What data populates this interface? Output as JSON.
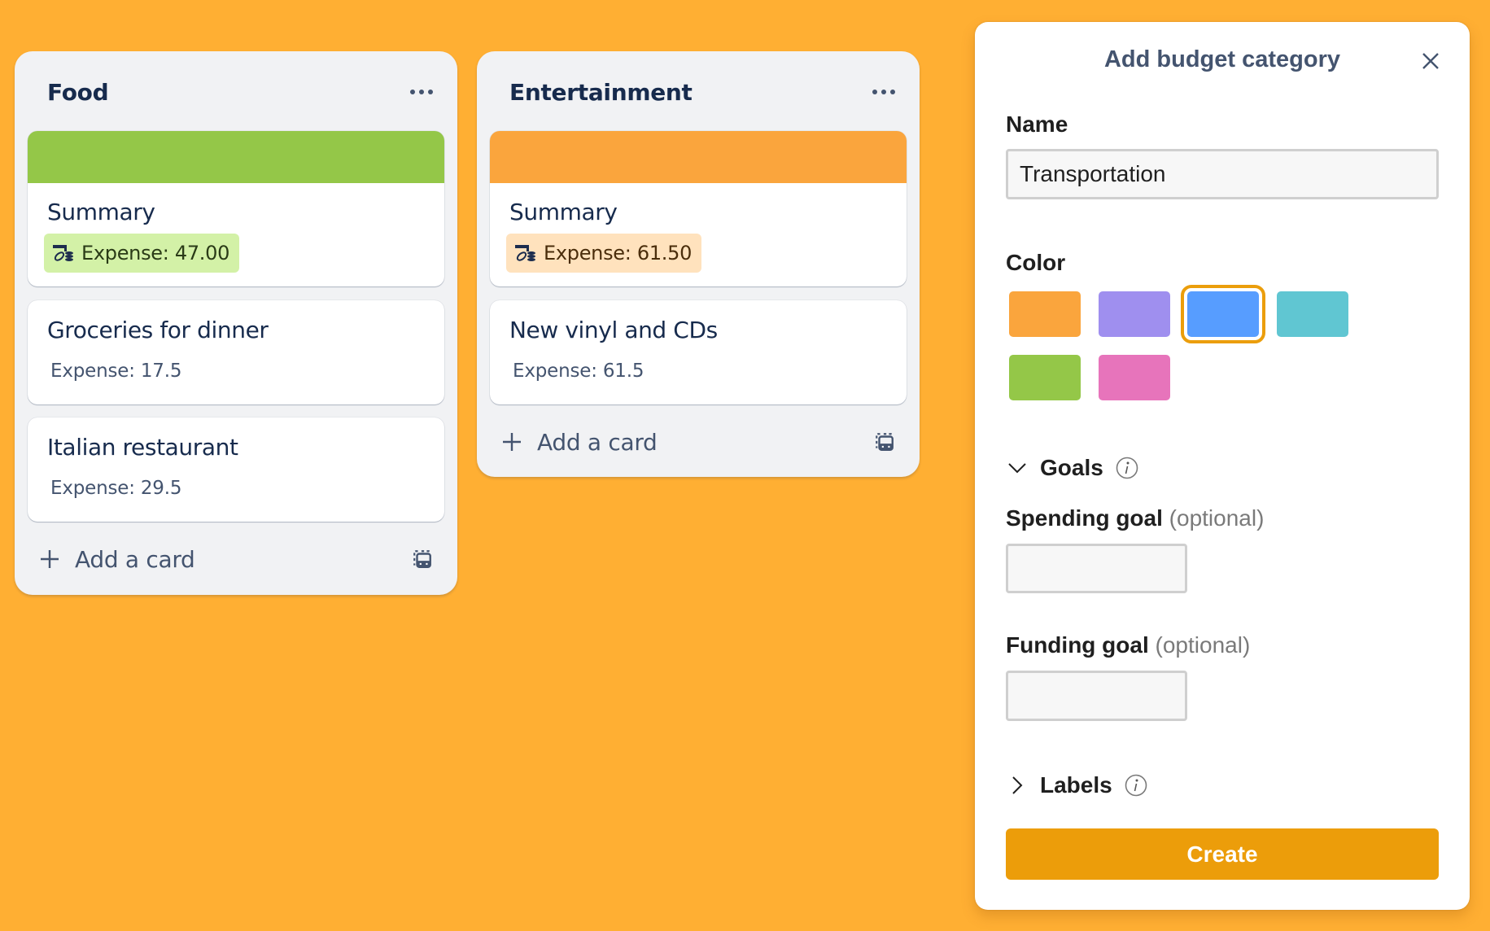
{
  "board": {
    "columns": [
      {
        "title": "Food",
        "color": "#94C748",
        "summary": {
          "title": "Summary",
          "expense_label": "Expense: 47.00",
          "badge_bg": "#D3F1A7",
          "badge_text_color": "#2A3B17"
        },
        "cards": [
          {
            "title": "Groceries for dinner",
            "expense": "Expense: 17.5"
          },
          {
            "title": "Italian restaurant",
            "expense": "Expense: 29.5"
          }
        ],
        "add_card_label": "Add a card"
      },
      {
        "title": "Entertainment",
        "color": "#FAA53D",
        "summary": {
          "title": "Summary",
          "expense_label": "Expense: 61.50",
          "badge_bg": "#FFE2BD",
          "badge_text_color": "#4A2D0B"
        },
        "cards": [
          {
            "title": "New vinyl and CDs",
            "expense": "Expense: 61.5"
          }
        ],
        "add_card_label": "Add a card"
      }
    ]
  },
  "panel": {
    "title": "Add budget category",
    "name_label": "Name",
    "name_value": "Transportation",
    "color_label": "Color",
    "colors": [
      {
        "name": "orange",
        "hex": "#FAA53D",
        "selected": false
      },
      {
        "name": "purple",
        "hex": "#9F8FEF",
        "selected": false
      },
      {
        "name": "blue",
        "hex": "#579DFF",
        "selected": true
      },
      {
        "name": "teal",
        "hex": "#60C6D2",
        "selected": false
      },
      {
        "name": "green",
        "hex": "#94C748",
        "selected": false
      },
      {
        "name": "magenta",
        "hex": "#E774BB",
        "selected": false
      }
    ],
    "selected_ring_color": "#EB9E0C",
    "goals": {
      "label": "Goals",
      "expanded": true,
      "spending_goal_label": "Spending goal",
      "spending_goal_optional": "(optional)",
      "spending_goal_value": "",
      "funding_goal_label": "Funding goal",
      "funding_goal_optional": "(optional)",
      "funding_goal_value": ""
    },
    "labels": {
      "label": "Labels",
      "expanded": false
    },
    "create_label": "Create",
    "create_color": "#EC9D0A"
  },
  "background_color": "#FFAF33"
}
